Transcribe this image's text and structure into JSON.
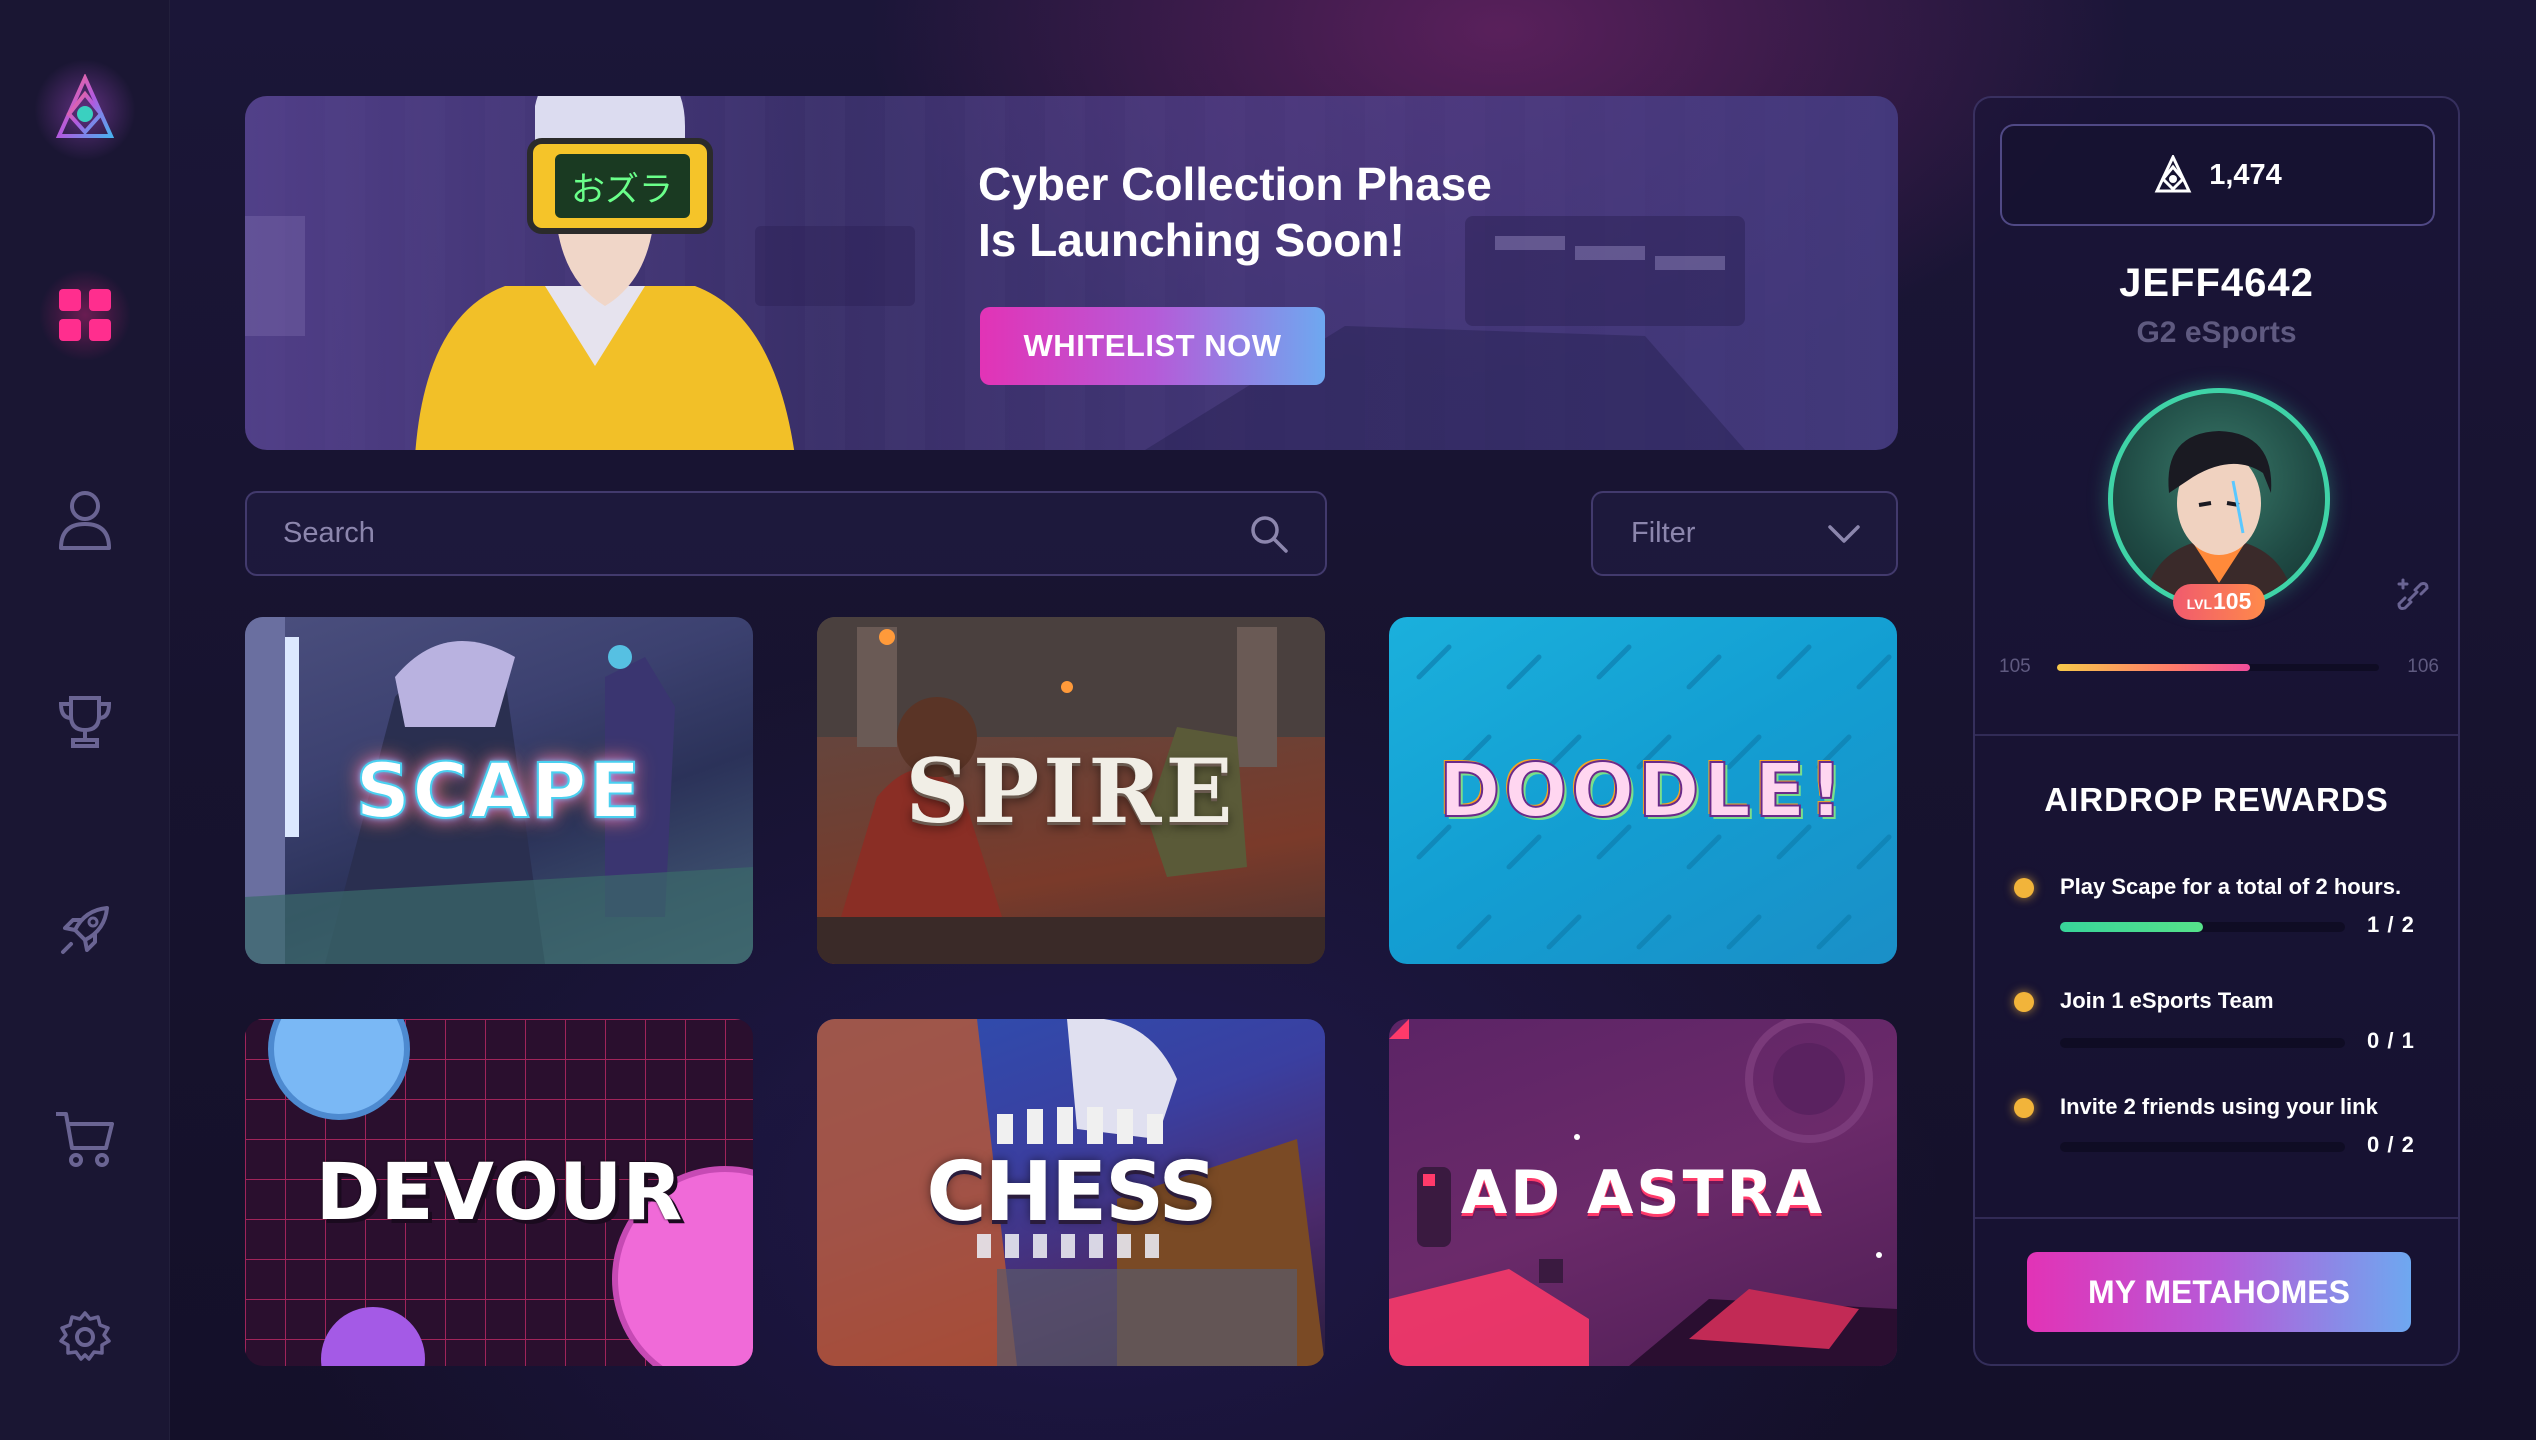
{
  "sidebar": {
    "items": [
      {
        "name": "logo",
        "icon": "app-logo-icon"
      },
      {
        "name": "dashboard",
        "icon": "grid-icon",
        "active": true,
        "color": "#ff2e8e"
      },
      {
        "name": "profile",
        "icon": "user-icon"
      },
      {
        "name": "tournaments",
        "icon": "trophy-icon"
      },
      {
        "name": "launch",
        "icon": "rocket-icon"
      },
      {
        "name": "store",
        "icon": "cart-icon"
      },
      {
        "name": "settings",
        "icon": "gear-icon"
      }
    ]
  },
  "banner": {
    "title_line1": "Cyber Collection Phase",
    "title_line2": "Is Launching Soon!",
    "sign_text": "おズラ",
    "cta_label": "WHITELIST NOW"
  },
  "search": {
    "placeholder": "Search"
  },
  "filter": {
    "label": "Filter"
  },
  "games": [
    {
      "title": "SCAPE"
    },
    {
      "title": "SPIRE"
    },
    {
      "title": "DOODLE!"
    },
    {
      "title": "DEVOUR"
    },
    {
      "title": "CHESS"
    },
    {
      "title": "AD ASTRA"
    }
  ],
  "profile": {
    "coins": "1,474",
    "username": "JEFF4642",
    "team": "G2 eSports",
    "level_prefix": "LVL",
    "level": "105",
    "xp_from": "105",
    "xp_to": "106",
    "xp_progress": 0.6
  },
  "airdrop": {
    "title": "AIRDROP REWARDS",
    "tasks": [
      {
        "text": "Play Scape for a total of 2 hours.",
        "count": "1 / 2",
        "progress": 0.5
      },
      {
        "text": "Join 1 eSports Team",
        "count": "0 / 1",
        "progress": 0
      },
      {
        "text": "Invite 2 friends using your link",
        "count": "0 / 2",
        "progress": 0
      }
    ]
  },
  "cta": {
    "metahomes_label": "MY METAHOMES"
  },
  "colors": {
    "accent_pink": "#e233b6",
    "accent_blue": "#6ea8f0",
    "avatar_ring": "#3fd3a7",
    "task_dot": "#f2b43a"
  }
}
